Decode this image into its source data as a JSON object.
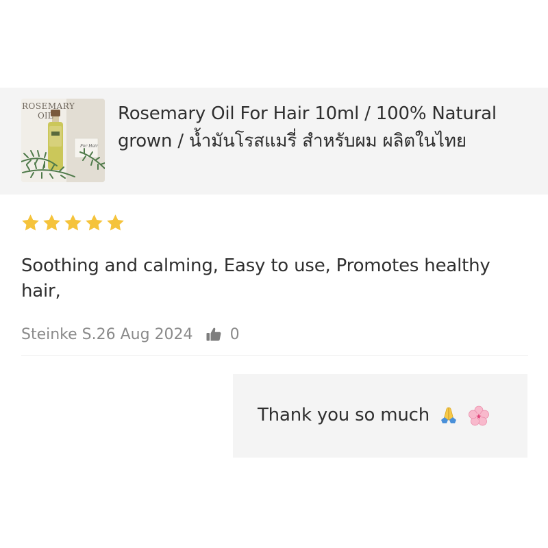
{
  "product": {
    "thumbnail_icon": "rosemary-oil-bottle-photo",
    "thumbnail_text_line1": "ROSEMARY",
    "thumbnail_text_line2": "OIL",
    "thumbnail_text_label": "For Hair",
    "title": "Rosemary Oil For Hair 10ml / 100% Natural grown / น้ำมันโรสแมรี่ สำหรับผม ผลิตในไทย"
  },
  "review": {
    "rating": 5,
    "rating_max": 5,
    "star_color": "#f5c33b",
    "text": "Soothing and calming, Easy to use, Promotes healthy hair,",
    "author_date": "Steinke S.26 Aug 2024",
    "like_icon": "thumbs-up-icon",
    "like_count": "0"
  },
  "reply": {
    "text": "Thank you so much",
    "emoji_1": "folded-hands-emoji",
    "emoji_2": "cherry-blossom-emoji"
  },
  "colors": {
    "panel_background": "#f4f4f4",
    "text_primary": "#2f2f2f",
    "text_secondary": "#8a8a8a"
  }
}
